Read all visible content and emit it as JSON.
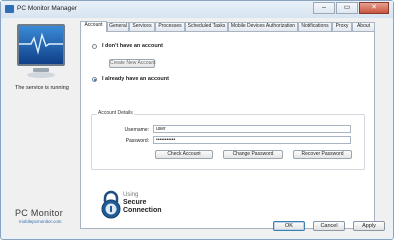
{
  "window": {
    "title": "PC Monitor Manager",
    "controls": {
      "minimize": "–",
      "maximize": "▭",
      "close": "✕"
    }
  },
  "sidebar": {
    "status_text": "The service is running",
    "logo": {
      "name": "PC Monitor",
      "url": "mobilepcmonitor.com"
    }
  },
  "tabs": [
    {
      "label": "Account",
      "active": true
    },
    {
      "label": "General"
    },
    {
      "label": "Services"
    },
    {
      "label": "Processes"
    },
    {
      "label": "Scheduled Tasks"
    },
    {
      "label": "Mobile Devices Authorization"
    },
    {
      "label": "Notifications"
    },
    {
      "label": "Proxy"
    },
    {
      "label": "About"
    }
  ],
  "account": {
    "no_account_label": "I don't have an account",
    "create_button": "Create New Account",
    "have_account_label": "I already have an account",
    "selected_option": "have_account",
    "details_title": "Account Details",
    "username_label": "Username:",
    "username_value": "user",
    "password_label": "Password:",
    "password_value": "•••••••••••",
    "check_button": "Check Account",
    "change_button": "Change Password",
    "recover_button": "Recover Password"
  },
  "secure": {
    "using": "Using",
    "line1": "Secure",
    "line2": "Connection"
  },
  "footer": {
    "ok": "OK",
    "cancel": "Cancel",
    "apply": "Apply"
  },
  "colors": {
    "accent": "#2b6fb0",
    "tab_border": "#a8b4c1"
  }
}
